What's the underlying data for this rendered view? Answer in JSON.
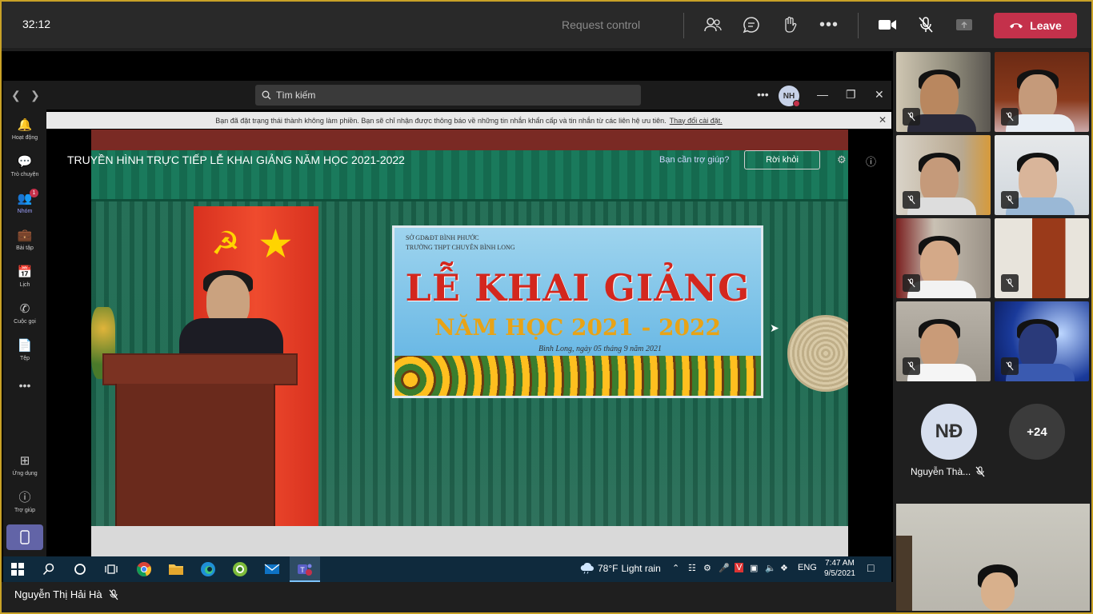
{
  "meeting": {
    "timer": "32:12",
    "request_control": "Request control",
    "leave_label": "Leave"
  },
  "teams_window": {
    "search_placeholder": "Tìm kiếm",
    "user_initials": "NH",
    "notice_text": "Bạn đã đặt trạng thái thành không làm phiền. Bạn sẽ chỉ nhận được thông báo về những tin nhắn khẩn cấp và tin nhắn từ các liên hệ ưu tiên.",
    "notice_link": "Thay đổi cài đặt.",
    "rail": [
      {
        "label": "Hoạt động",
        "icon": "bell-icon"
      },
      {
        "label": "Trò chuyện",
        "icon": "chat-icon"
      },
      {
        "label": "Nhóm",
        "icon": "teams-icon",
        "badge": "1"
      },
      {
        "label": "Bài tập",
        "icon": "assignments-icon"
      },
      {
        "label": "Lịch",
        "icon": "calendar-icon"
      },
      {
        "label": "Cuộc gọi",
        "icon": "phone-icon"
      },
      {
        "label": "Tệp",
        "icon": "file-icon"
      },
      {
        "label": "Ứng dụng",
        "icon": "apps-icon"
      },
      {
        "label": "Trợ giúp",
        "icon": "help-icon"
      }
    ]
  },
  "stream": {
    "title": "TRUYỀN HÌNH TRỰC TIẾP LỄ KHAI GIẢNG NĂM HỌC 2021-2022",
    "help_link": "Bạn cần trợ giúp?",
    "leave_button": "Rời khỏi",
    "banner": {
      "line1": "SỞ GD&ĐT BÌNH PHƯỚC",
      "line2": "TRƯỜNG THPT CHUYÊN BÌNH LONG",
      "heading": "LỄ KHAI GIẢNG",
      "year": "NĂM HỌC 2021 - 2022",
      "date": "Bình Long, ngày 05 tháng 9 năm 2021"
    }
  },
  "taskbar": {
    "weather_temp": "78°F",
    "weather_desc": "Light rain",
    "language": "ENG",
    "time": "7:47 AM",
    "date": "9/5/2021"
  },
  "presenter_name": "Nguyễn Thị Hải Hà",
  "participants": {
    "avatar_initials": "NĐ",
    "avatar_name": "Nguyễn Thà...",
    "more_count": "+24"
  }
}
